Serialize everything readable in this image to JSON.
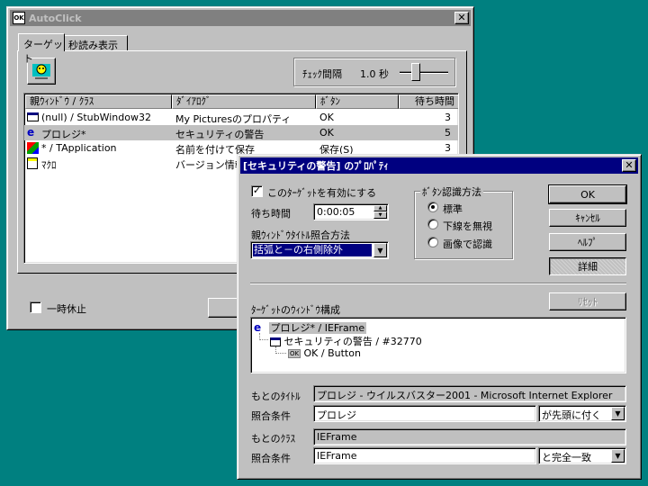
{
  "main": {
    "title": "AutoClick",
    "app_icon": "OK",
    "tabs": [
      {
        "label": "ターゲット"
      },
      {
        "label": "秒読み表示"
      }
    ],
    "interval": {
      "label": "ﾁｪｯｸ間隔",
      "value": "1.0 秒"
    },
    "columns": [
      "親ｳｨﾝﾄﾞｳ / ｸﾗｽ",
      "ﾀﾞｲｱﾛｸﾞ",
      "ﾎﾞﾀﾝ",
      "待ち時間"
    ],
    "rows": [
      {
        "icon": "window-icon",
        "parent": "(null) / StubWindow32",
        "dialog": "My Picturesのプロパティ",
        "button": "OK",
        "wait": "3"
      },
      {
        "icon": "ie-icon",
        "parent": "プロレジ*",
        "dialog": "セキュリティの警告",
        "button": "OK",
        "wait": "5"
      },
      {
        "icon": "app-icon",
        "parent": "* / TApplication",
        "dialog": "名前を付けて保存",
        "button": "保存(S)",
        "wait": "3"
      },
      {
        "icon": "macro-icon",
        "parent": "ﾏｸﾛ",
        "dialog": "バージョン情報",
        "button": "",
        "wait": ""
      }
    ],
    "pause_label": "一時休止"
  },
  "props": {
    "title": "[セキュリティの警告] のﾌﾟﾛﾊﾟﾃｨ",
    "enable_label": "このﾀｰｹﾞｯﾄを有効にする",
    "wait_label": "待ち時間",
    "wait_value": "0:00:05",
    "match_method_label": "親ｳｨﾝﾄﾞｳﾀｲﾄﾙ照合方法",
    "match_method_value": "括弧と－の右側除外",
    "button_group_label": "ﾎﾞﾀﾝ認識方法",
    "radio_options": [
      "標準",
      "下線を無視",
      "画像で認識"
    ],
    "buttons": {
      "ok": "OK",
      "cancel": "ｷｬﾝｾﾙ",
      "help": "ﾍﾙﾌﾟ",
      "detail": "詳細",
      "reset": "ﾘｾｯﾄ"
    },
    "tree_label": "ﾀｰｹﾞｯﾄのｳｨﾝﾄﾞｳ構成",
    "tree": [
      {
        "text": "プロレジ* / IEFrame"
      },
      {
        "text": "セキュリティの警告 / #32770"
      },
      {
        "text": "OK / Button",
        "icon_text": "OK"
      }
    ],
    "orig_title_label": "もとのﾀｲﾄﾙ",
    "orig_title_value": "プロレジ - ウイルスバスター2001 - Microsoft Internet Explorer",
    "title_cond_label": "照合条件",
    "title_cond_value": "プロレジ",
    "title_cond_mode": "が先頭に付く",
    "orig_class_label": "もとのｸﾗｽ",
    "orig_class_value": "IEFrame",
    "class_cond_label": "照合条件",
    "class_cond_value": "IEFrame",
    "class_cond_mode": "と完全一致"
  }
}
